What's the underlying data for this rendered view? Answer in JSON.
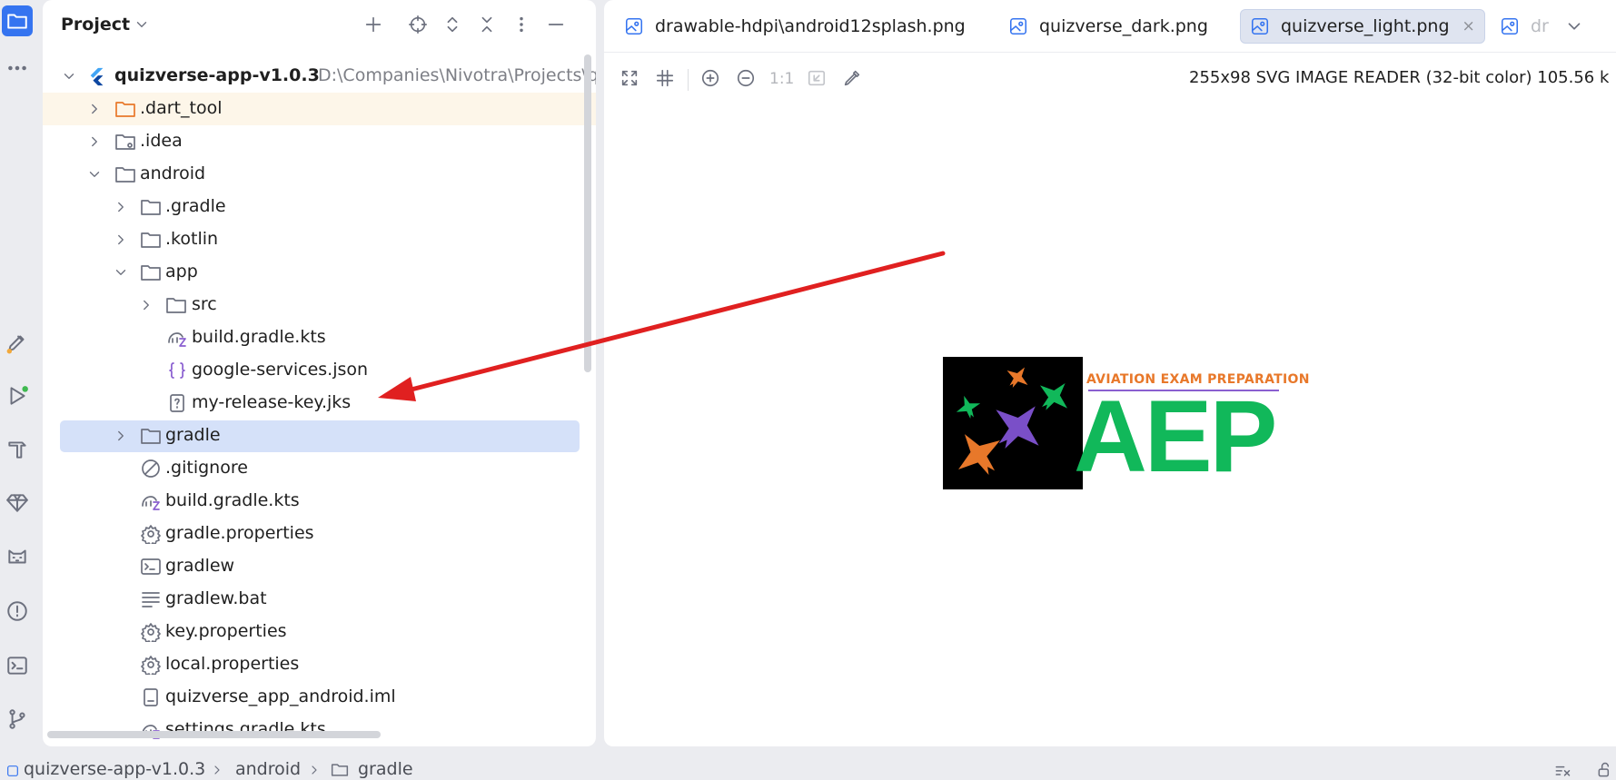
{
  "project_panel": {
    "title": "Project",
    "tree": [
      {
        "label": "quizverse-app-v1.0.3",
        "path": "D:\\Companies\\Nivotra\\Projects\\q",
        "icon": "flutter-icon",
        "expanded": true
      },
      {
        "label": ".dart_tool",
        "icon": "folder-orange-icon",
        "expanded": false
      },
      {
        "label": ".idea",
        "icon": "folder-settings-icon",
        "expanded": false
      },
      {
        "label": "android",
        "icon": "folder-icon",
        "expanded": true
      },
      {
        "label": ".gradle",
        "icon": "folder-icon",
        "expanded": false
      },
      {
        "label": ".kotlin",
        "icon": "folder-icon",
        "expanded": false
      },
      {
        "label": "app",
        "icon": "folder-icon",
        "expanded": true
      },
      {
        "label": "src",
        "icon": "folder-icon",
        "expanded": false
      },
      {
        "label": "build.gradle.kts",
        "icon": "gradle-kotlin-icon"
      },
      {
        "label": "google-services.json",
        "icon": "json-icon"
      },
      {
        "label": "my-release-key.jks",
        "icon": "unknown-file-icon"
      },
      {
        "label": "gradle",
        "icon": "folder-icon",
        "expanded": false
      },
      {
        "label": ".gitignore",
        "icon": "ignore-file-icon"
      },
      {
        "label": "build.gradle.kts",
        "icon": "gradle-kotlin-icon"
      },
      {
        "label": "gradle.properties",
        "icon": "properties-gear-icon"
      },
      {
        "label": "gradlew",
        "icon": "shell-script-icon"
      },
      {
        "label": "gradlew.bat",
        "icon": "text-file-icon"
      },
      {
        "label": "key.properties",
        "icon": "properties-gear-icon"
      },
      {
        "label": "local.properties",
        "icon": "properties-gear-icon"
      },
      {
        "label": "quizverse_app_android.iml",
        "icon": "iml-file-icon"
      },
      {
        "label": "settings.gradle.kts",
        "icon": "gradle-kotlin-icon"
      }
    ]
  },
  "editor": {
    "tabs": [
      {
        "label": "drawable-hdpi\\android12splash.png",
        "active": false
      },
      {
        "label": "quizverse_dark.png",
        "active": false
      },
      {
        "label": "quizverse_light.png",
        "active": true
      },
      {
        "label": "dr",
        "active": false
      }
    ],
    "close_glyph": "×",
    "toolbar": {
      "actual_size_label": "1:1"
    },
    "image_info": "255x98 SVG IMAGE READER (32-bit color) 105.56 k",
    "logo": {
      "subtitle": "AVIATION EXAM PREPARATION",
      "text": "AEP",
      "colors": {
        "green": "#11B85A",
        "orange": "#E8782A",
        "purple": "#7A4FC8",
        "black": "#000000"
      }
    }
  },
  "status_bar": {
    "breadcrumbs": [
      "quizverse-app-v1.0.3",
      "android",
      "gradle"
    ]
  },
  "annotation": {
    "arrow_color": "#E02020"
  }
}
